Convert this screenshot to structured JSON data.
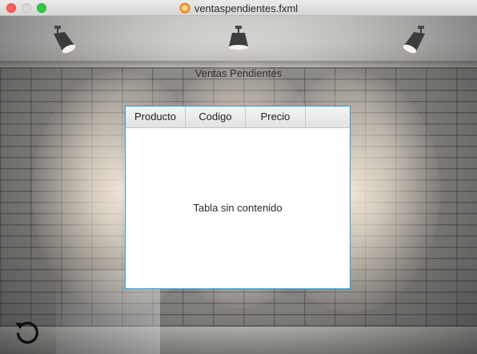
{
  "window": {
    "title": "ventaspendientes.fxml"
  },
  "heading": "Ventas Pendientes",
  "table": {
    "columns": [
      "Producto",
      "Codigo",
      "Precio"
    ],
    "rows": [],
    "empty_text": "Tabla sin contenido"
  },
  "controls": {
    "refresh_icon": "refresh-icon"
  },
  "colors": {
    "accent_border": "#2a9ad0",
    "close": "#fc605c",
    "maximize": "#34c84a"
  }
}
